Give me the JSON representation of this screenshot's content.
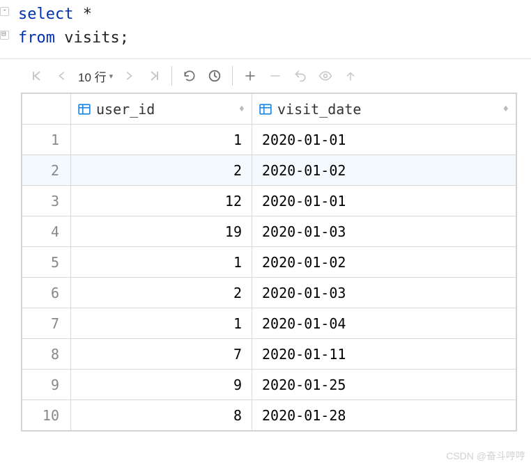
{
  "sql": {
    "line1_kw": "select",
    "line1_rest": " *",
    "line2_kw": "from",
    "line2_rest": " visits;"
  },
  "toolbar": {
    "page_label": "10 行"
  },
  "columns": {
    "user_id": "user_id",
    "visit_date": "visit_date"
  },
  "rows": [
    {
      "n": "1",
      "user_id": "1",
      "visit_date": "2020-01-01"
    },
    {
      "n": "2",
      "user_id": "2",
      "visit_date": "2020-01-02"
    },
    {
      "n": "3",
      "user_id": "12",
      "visit_date": "2020-01-01"
    },
    {
      "n": "4",
      "user_id": "19",
      "visit_date": "2020-01-03"
    },
    {
      "n": "5",
      "user_id": "1",
      "visit_date": "2020-01-02"
    },
    {
      "n": "6",
      "user_id": "2",
      "visit_date": "2020-01-03"
    },
    {
      "n": "7",
      "user_id": "1",
      "visit_date": "2020-01-04"
    },
    {
      "n": "8",
      "user_id": "7",
      "visit_date": "2020-01-11"
    },
    {
      "n": "9",
      "user_id": "9",
      "visit_date": "2020-01-25"
    },
    {
      "n": "10",
      "user_id": "8",
      "visit_date": "2020-01-28"
    }
  ],
  "watermark": "CSDN @奋斗哼哼"
}
